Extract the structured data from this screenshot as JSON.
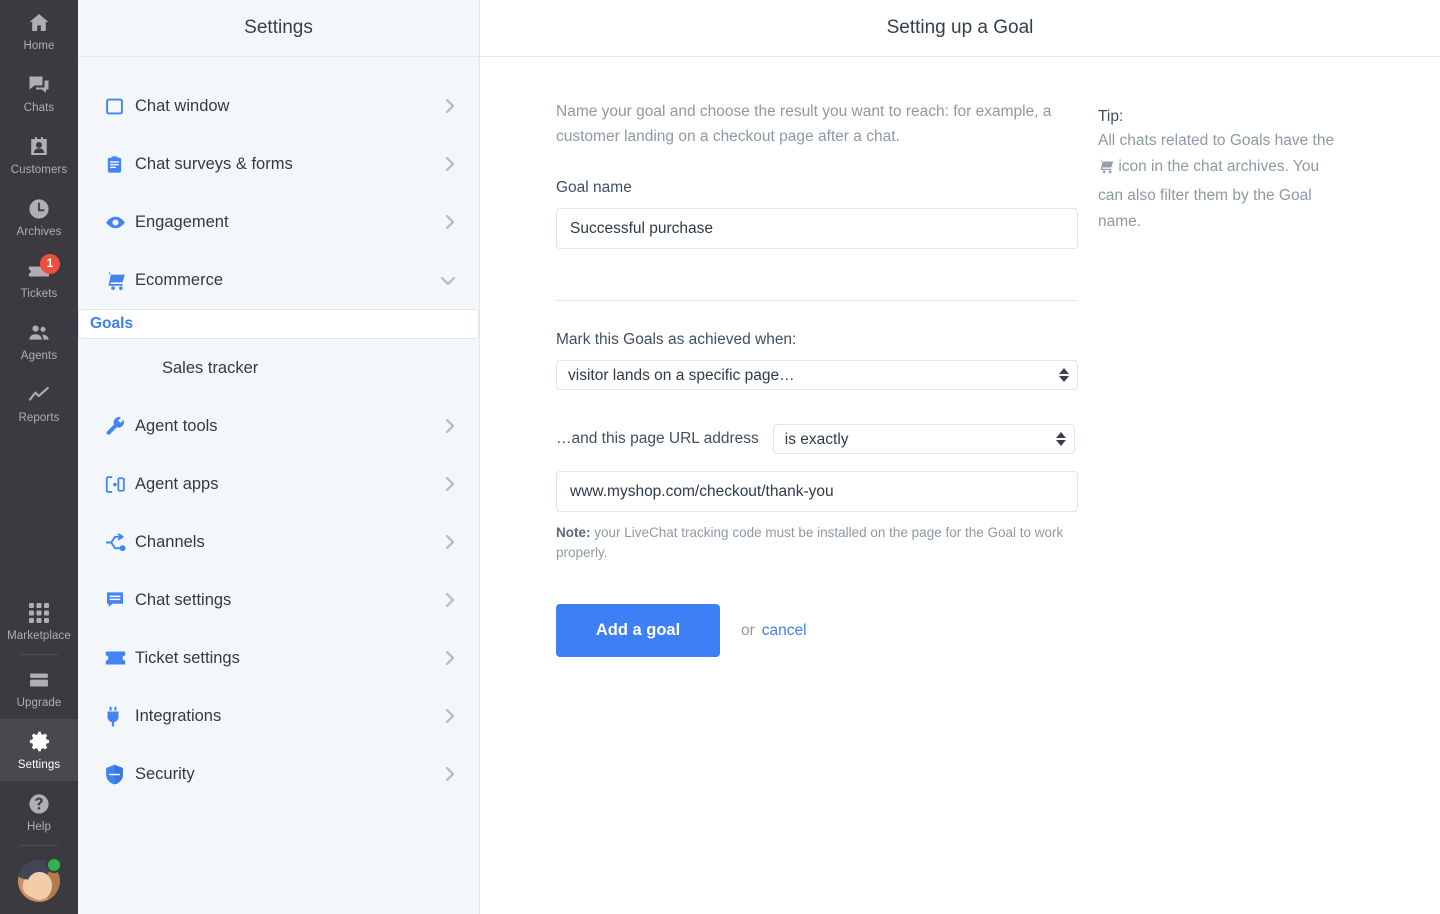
{
  "rail": {
    "top_items": [
      {
        "label": "Home",
        "icon": "home-icon",
        "active": false,
        "badge": null
      },
      {
        "label": "Chats",
        "icon": "chats-icon",
        "active": false,
        "badge": null
      },
      {
        "label": "Customers",
        "icon": "customers-icon",
        "active": false,
        "badge": null
      },
      {
        "label": "Archives",
        "icon": "archives-icon",
        "active": false,
        "badge": null
      },
      {
        "label": "Tickets",
        "icon": "tickets-icon",
        "active": false,
        "badge": "1"
      },
      {
        "label": "Agents",
        "icon": "agents-icon",
        "active": false,
        "badge": null
      },
      {
        "label": "Reports",
        "icon": "reports-icon",
        "active": false,
        "badge": null
      }
    ],
    "bottom_items": [
      {
        "label": "Marketplace",
        "icon": "marketplace-icon",
        "active": false
      },
      {
        "label": "Upgrade",
        "icon": "upgrade-icon",
        "active": false
      },
      {
        "label": "Settings",
        "icon": "gear-icon",
        "active": true
      },
      {
        "label": "Help",
        "icon": "help-icon",
        "active": false
      }
    ],
    "avatar_status": "online",
    "badge_color": "#ee4f3d",
    "active_bg": "#4a484f",
    "background": "#3b3a40"
  },
  "settings": {
    "title": "Settings",
    "items": [
      {
        "label": "Chat window",
        "icon": "window-icon",
        "expandable": true,
        "expanded": false
      },
      {
        "label": "Chat surveys & forms",
        "icon": "clipboard-icon",
        "expandable": true,
        "expanded": false
      },
      {
        "label": "Engagement",
        "icon": "eye-icon",
        "expandable": true,
        "expanded": false
      },
      {
        "label": "Ecommerce",
        "icon": "cart-icon",
        "expandable": true,
        "expanded": true
      },
      {
        "label": "Agent tools",
        "icon": "wrench-icon",
        "expandable": true,
        "expanded": false
      },
      {
        "label": "Agent apps",
        "icon": "apps-icon",
        "expandable": true,
        "expanded": false
      },
      {
        "label": "Channels",
        "icon": "channels-icon",
        "expandable": true,
        "expanded": false
      },
      {
        "label": "Chat settings",
        "icon": "message-icon",
        "expandable": true,
        "expanded": false
      },
      {
        "label": "Ticket settings",
        "icon": "ticket-icon",
        "expandable": true,
        "expanded": false
      },
      {
        "label": "Integrations",
        "icon": "plug-icon",
        "expandable": true,
        "expanded": false
      },
      {
        "label": "Security",
        "icon": "shield-icon",
        "expandable": true,
        "expanded": false
      }
    ],
    "sub_items": [
      {
        "label": "Goals",
        "selected": true
      },
      {
        "label": "Sales tracker",
        "selected": false
      }
    ],
    "accent_color": "#4384f5",
    "selected_color": "#3e7ff5"
  },
  "main": {
    "title": "Setting up a Goal",
    "intro": "Name your goal and choose the result you want to reach: for example, a customer landing on a checkout page after a chat.",
    "goal_name_label": "Goal name",
    "goal_name_value": "Successful purchase",
    "goal_name_placeholder": "Goal name",
    "achieved_label": "Mark this Goals as achieved when:",
    "achieved_value": "visitor lands on a specific page…",
    "achieved_options": [
      "visitor lands on a specific page…"
    ],
    "url_label": "…and this page URL address",
    "url_match_value": "is exactly",
    "url_match_options": [
      "is exactly"
    ],
    "url_value": "www.myshop.com/checkout/thank-you",
    "url_placeholder": "www.myshop.com/checkout/thank-you",
    "note_prefix": "Note:",
    "note_text": " your LiveChat tracking code must be installed on the page for the Goal to work properly.",
    "submit_label": "Add a goal",
    "or_label": "or",
    "cancel_label": "cancel",
    "primary_color": "#3e7ff5"
  },
  "tip": {
    "title": "Tip:",
    "line1": "All chats related to Goals have the",
    "icon": "cart-icon",
    "line2": "icon in the chat archives. You can also filter them by the Goal name."
  }
}
